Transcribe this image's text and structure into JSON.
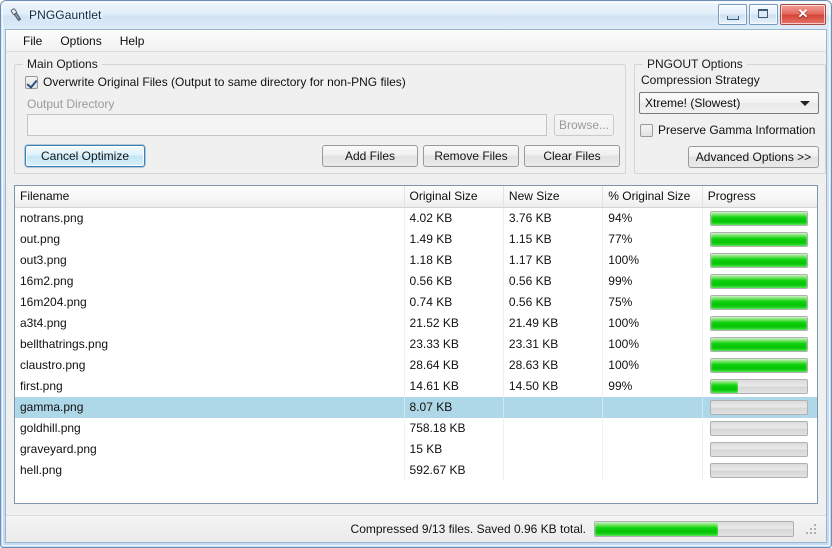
{
  "window": {
    "title": "PNGGauntlet",
    "icon": "gauntlet-icon",
    "minimize_label": "",
    "maximize_label": "",
    "close_label": "✕"
  },
  "menubar": {
    "items": [
      {
        "label": "File"
      },
      {
        "label": "Options"
      },
      {
        "label": "Help"
      }
    ]
  },
  "main_options": {
    "title": "Main Options",
    "overwrite_checkbox": {
      "label": "Overwrite Original Files (Output to same directory for non-PNG files)",
      "checked": true
    },
    "output_directory_label": "Output Directory",
    "output_directory_value": "",
    "output_directory_placeholder": "",
    "browse_button": "Browse...",
    "cancel_button": "Cancel Optimize",
    "add_files_button": "Add Files",
    "remove_files_button": "Remove Files",
    "clear_files_button": "Clear Files"
  },
  "pngout_options": {
    "title": "PNGOUT Options",
    "compression_strategy_label": "Compression Strategy",
    "compression_strategy_value": "Xtreme! (Slowest)",
    "preserve_gamma_checkbox": {
      "label": "Preserve Gamma Information",
      "checked": false
    },
    "advanced_button": "Advanced Options >>"
  },
  "file_list": {
    "columns": [
      {
        "label": "Filename",
        "key": "filename"
      },
      {
        "label": "Original Size",
        "key": "original_size"
      },
      {
        "label": "New Size",
        "key": "new_size"
      },
      {
        "label": "% Original Size",
        "key": "pct_original"
      },
      {
        "label": "Progress",
        "key": "progress"
      }
    ],
    "rows": [
      {
        "filename": "notrans.png",
        "original_size": "4.02 KB",
        "new_size": "3.76 KB",
        "pct_original": "94%",
        "progress": 100,
        "selected": false
      },
      {
        "filename": "out.png",
        "original_size": "1.49 KB",
        "new_size": "1.15 KB",
        "pct_original": "77%",
        "progress": 100,
        "selected": false
      },
      {
        "filename": "out3.png",
        "original_size": "1.18 KB",
        "new_size": "1.17 KB",
        "pct_original": "100%",
        "progress": 100,
        "selected": false
      },
      {
        "filename": "16m2.png",
        "original_size": "0.56 KB",
        "new_size": "0.56 KB",
        "pct_original": "99%",
        "progress": 100,
        "selected": false
      },
      {
        "filename": "16m204.png",
        "original_size": "0.74 KB",
        "new_size": "0.56 KB",
        "pct_original": "75%",
        "progress": 100,
        "selected": false
      },
      {
        "filename": "a3t4.png",
        "original_size": "21.52 KB",
        "new_size": "21.49 KB",
        "pct_original": "100%",
        "progress": 100,
        "selected": false
      },
      {
        "filename": "bellthatrings.png",
        "original_size": "23.33 KB",
        "new_size": "23.31 KB",
        "pct_original": "100%",
        "progress": 100,
        "selected": false
      },
      {
        "filename": "claustro.png",
        "original_size": "28.64 KB",
        "new_size": "28.63 KB",
        "pct_original": "100%",
        "progress": 100,
        "selected": false
      },
      {
        "filename": "first.png",
        "original_size": "14.61 KB",
        "new_size": "14.50 KB",
        "pct_original": "99%",
        "progress": 28,
        "selected": false
      },
      {
        "filename": "gamma.png",
        "original_size": "8.07 KB",
        "new_size": "",
        "pct_original": "",
        "progress": 0,
        "selected": true
      },
      {
        "filename": "goldhill.png",
        "original_size": "758.18 KB",
        "new_size": "",
        "pct_original": "",
        "progress": 0,
        "selected": false
      },
      {
        "filename": "graveyard.png",
        "original_size": "15 KB",
        "new_size": "",
        "pct_original": "",
        "progress": 0,
        "selected": false
      },
      {
        "filename": "hell.png",
        "original_size": "592.67 KB",
        "new_size": "",
        "pct_original": "",
        "progress": 0,
        "selected": false
      }
    ]
  },
  "statusbar": {
    "text": "Compressed 9/13 files. Saved 0.96 KB total.",
    "progress": 62
  },
  "colors": {
    "progress_green": "#0ccb0c",
    "selection_blue": "#aed7e7",
    "title_text": "#0a2a4a",
    "window_border": "#6d8fb5"
  }
}
